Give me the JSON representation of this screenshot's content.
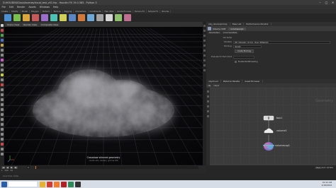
{
  "window": {
    "title": "D:/HOUDINI/Cloud/scenes/cloud_test_v01.hip - Houdini FX 19.0.383 - Python 3",
    "controls": [
      "–",
      "□",
      "✕"
    ]
  },
  "menu": [
    "File",
    "Edit",
    "Render",
    "Assets",
    "Windows",
    "Help"
  ],
  "shelf_tabs": [
    "Create",
    "Modify",
    "Model",
    "Polygon",
    "Deform",
    "Texture",
    "Rigging",
    "Characters",
    "Constraints",
    "Hair Utils",
    "Guide Process",
    "Terrain FX",
    "Simple FX",
    "Volume"
  ],
  "shelf_tool_colors": [
    "#4e8fd0",
    "#7bbf4e",
    "#d9a640",
    "#c45a5a",
    "#9a6fc9",
    "#4ec2b3",
    "#cfcf5a",
    "#5a87c4",
    "#d07a3d",
    "#6fa7d6",
    "#a3a3a3",
    "#d6d6d6",
    "#8fbf6f",
    "#bf6f8f"
  ],
  "viewport": {
    "tabs": [
      "Scene View",
      "Render View",
      "Composite View"
    ],
    "caption": "Crossbow skinned geometry",
    "detail": "cloud1.vdb  |  density  |  grid res 256"
  },
  "params": {
    "panel_tabs": [
      "obj_clouds/prmop",
      "Take List",
      "Performance Monitor"
    ],
    "node_type": "Volume VOP",
    "node_name": "volumevop1",
    "sub_tabs": [
      "Parameters",
      "Local Variables"
    ],
    "rows": [
      {
        "label": "Vex Setup",
        "value": ""
      },
      {
        "label": "Variables",
        "value": "@P, @density, @color, @vel, @MaskVar"
      },
      {
        "label": "Bindings",
        "value": "density"
      }
    ],
    "button": "Create Bindings",
    "checkbox_label": "Enable Multithreading",
    "extra_field": "Evaluate for Each Point"
  },
  "network": {
    "panel_tabs": [
      "obj/cloud",
      "Material Palette",
      "Asset Browser"
    ],
    "path": [
      "obj",
      "cloud"
    ],
    "context_label": "Geometry",
    "nodes": [
      {
        "name": "box1"
      },
      {
        "name": "volume1"
      },
      {
        "name": "volumevop1"
      }
    ]
  },
  "timeline": {
    "frame": "1",
    "start": "1",
    "end": "240",
    "fps": "24",
    "buttons": [
      "|◀",
      "◀",
      "▶",
      "▶|"
    ],
    "keys_label": "Keys",
    "mode": "Auto Update"
  },
  "status": {
    "message": "Cook time: 0.84s"
  },
  "taskbar": {
    "time": "10:22 AM",
    "date": "2/18/2024",
    "icon_colors": [
      "#2a5ea8",
      "#ffffff",
      "#e8b22c",
      "#d43b2f",
      "#2e8b57",
      "#f07c2a",
      "#b02020",
      "#333333"
    ]
  }
}
